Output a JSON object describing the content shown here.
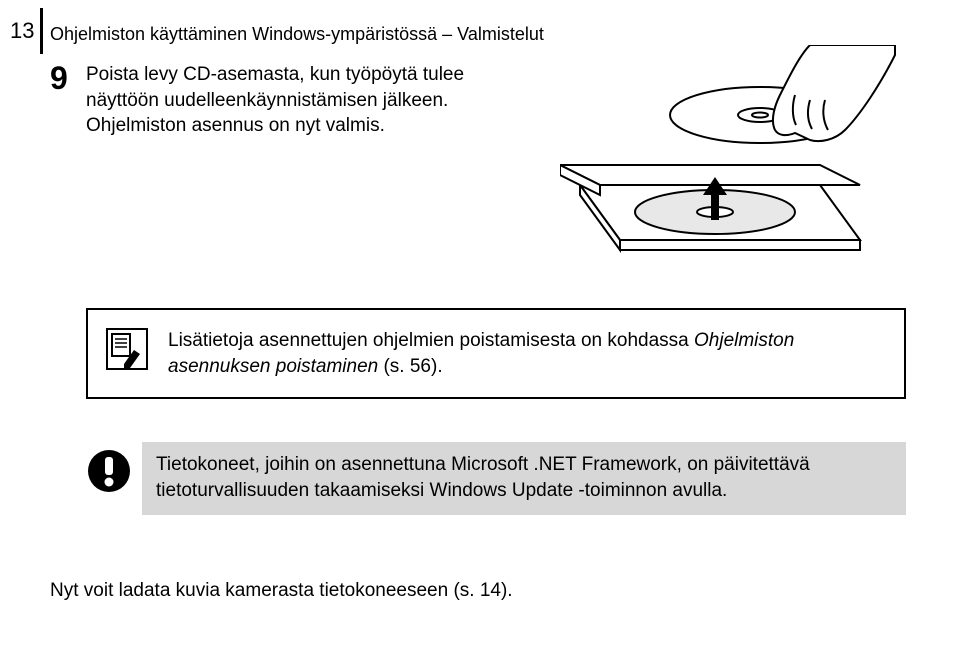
{
  "page_number": "13",
  "header": "Ohjelmiston käyttäminen Windows-ympäristössä – Valmistelut",
  "step": {
    "number": "9",
    "line1": "Poista levy CD-asemasta, kun työpöytä tulee näyttöön uudelleenkäynnistämisen jälkeen.",
    "line2": "Ohjelmiston asennus on nyt valmis."
  },
  "info": {
    "text_prefix": "Lisätietoja asennettujen ohjelmien poistamisesta on kohdassa ",
    "text_italic": "Ohjelmiston asennuksen poistaminen",
    "text_suffix": " (s. 56)."
  },
  "warning": {
    "text": "Tietokoneet, joihin on asennettuna Microsoft .NET Framework, on päivitettävä tietoturvallisuuden takaamiseksi Windows Update -toiminnon avulla."
  },
  "footer": "Nyt voit ladata kuvia kamerasta tietokoneeseen (s. 14)."
}
